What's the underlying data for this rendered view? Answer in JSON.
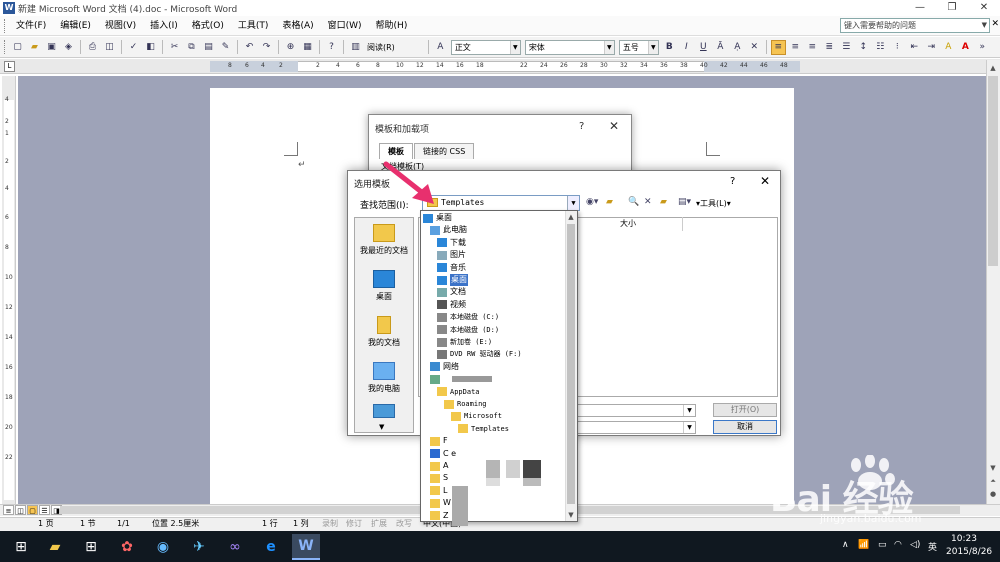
{
  "window": {
    "title": "新建 Microsoft Word 文档 (4).doc - Microsoft Word",
    "app_icon": "W",
    "buttons": [
      "—",
      "❐",
      "✕"
    ]
  },
  "menu": {
    "items": [
      "文件(F)",
      "编辑(E)",
      "视图(V)",
      "插入(I)",
      "格式(O)",
      "工具(T)",
      "表格(A)",
      "窗口(W)",
      "帮助(H)"
    ],
    "help_placeholder": "键入需要帮助的问题",
    "close_glyph": "✕"
  },
  "toolbar": {
    "read_label": "阅读(R)",
    "style_value": "正文",
    "font_value": "宋体",
    "size_value": "五号",
    "bold": "B",
    "italic": "I",
    "underline": "U",
    "font_color_glyph": "A",
    "highlight_glyph": "A"
  },
  "ruler": {
    "corner": "L",
    "top_ticks": [
      "8",
      "6",
      "4",
      "2",
      "2",
      "4",
      "6",
      "8",
      "10",
      "12",
      "14",
      "16",
      "18",
      "22",
      "24",
      "26",
      "28",
      "30",
      "32",
      "34",
      "36",
      "38",
      "40",
      "42",
      "44",
      "46",
      "48"
    ],
    "left_ticks": [
      "4",
      "2",
      "1",
      "2",
      "4",
      "6",
      "8",
      "10",
      "12",
      "14",
      "16",
      "18",
      "20",
      "22"
    ]
  },
  "dialog_back": {
    "title": "模板和加载项",
    "help": "?",
    "close": "✕",
    "tabs": [
      "模板",
      "链接的 CSS"
    ],
    "label": "文档模板(T)"
  },
  "dialog_front": {
    "title": "选用模板",
    "help": "?",
    "close": "✕",
    "lookin_label": "查找范围(I):",
    "lookin_value": "Templates",
    "tools_label": "▾工具(L)▾",
    "places": [
      "我最近的文档",
      "桌面",
      "我的文档",
      "我的电脑"
    ],
    "column_size": "大小",
    "open_label": "打开(O)",
    "cancel_label": "取消"
  },
  "tree": {
    "items": [
      {
        "label": "桌面",
        "indent": 0,
        "icon": "desktop-icon"
      },
      {
        "label": "此电脑",
        "indent": 1,
        "icon": "computer-icon"
      },
      {
        "label": "下载",
        "indent": 2,
        "icon": "download-icon"
      },
      {
        "label": "图片",
        "indent": 2,
        "icon": "pictures-icon"
      },
      {
        "label": "音乐",
        "indent": 2,
        "icon": "music-icon"
      },
      {
        "label": "桌面",
        "indent": 2,
        "icon": "desktop-icon",
        "selected": true
      },
      {
        "label": "文档",
        "indent": 2,
        "icon": "documents-icon"
      },
      {
        "label": "视频",
        "indent": 2,
        "icon": "video-icon"
      },
      {
        "label": "本地磁盘 (C:)",
        "indent": 2,
        "icon": "drive-icon",
        "mono": true
      },
      {
        "label": "本地磁盘 (D:)",
        "indent": 2,
        "icon": "drive-icon",
        "mono": true
      },
      {
        "label": "新加卷 (E:)",
        "indent": 2,
        "icon": "drive-icon",
        "mono": true
      },
      {
        "label": "DVD RW 驱动器 (F:)",
        "indent": 2,
        "icon": "dvd-icon",
        "mono": true
      },
      {
        "label": "网络",
        "indent": 1,
        "icon": "network-icon"
      },
      {
        "label": "",
        "indent": 1,
        "icon": "user-icon"
      },
      {
        "label": "AppData",
        "indent": 2,
        "icon": "folder-icon",
        "mono": true
      },
      {
        "label": "Roaming",
        "indent": 3,
        "icon": "folder-icon",
        "mono": true
      },
      {
        "label": "Microsoft",
        "indent": 4,
        "icon": "folder-icon",
        "mono": true
      },
      {
        "label": "Templates",
        "indent": 5,
        "icon": "folder-icon",
        "mono": true
      },
      {
        "label": "F",
        "indent": 1,
        "icon": "folder-icon"
      },
      {
        "label": "C  e",
        "indent": 1,
        "icon": "cloud-icon"
      },
      {
        "label": "A",
        "indent": 1,
        "icon": "folder-icon"
      },
      {
        "label": "S",
        "indent": 1,
        "icon": "folder-icon"
      },
      {
        "label": "L",
        "indent": 1,
        "icon": "folder-icon"
      },
      {
        "label": "W",
        "indent": 1,
        "icon": "folder-icon"
      },
      {
        "label": "Z",
        "indent": 1,
        "icon": "folder-icon"
      }
    ]
  },
  "statusbar": {
    "page": "1 页",
    "section": "1 节",
    "pagecount": "1/1",
    "position": "位置 2.5厘米",
    "line": "1 行",
    "col": "1 列",
    "rec": "录制",
    "trk": "修订",
    "ext": "扩展",
    "ovr": "改写",
    "lang": "中文(中国)"
  },
  "taskbar": {
    "time": "10:23",
    "date": "2015/8/26",
    "ime": "英",
    "tray_up": "∧"
  },
  "watermark": {
    "logo": "Bai  经验",
    "url": "jingyan.baidu.com"
  }
}
